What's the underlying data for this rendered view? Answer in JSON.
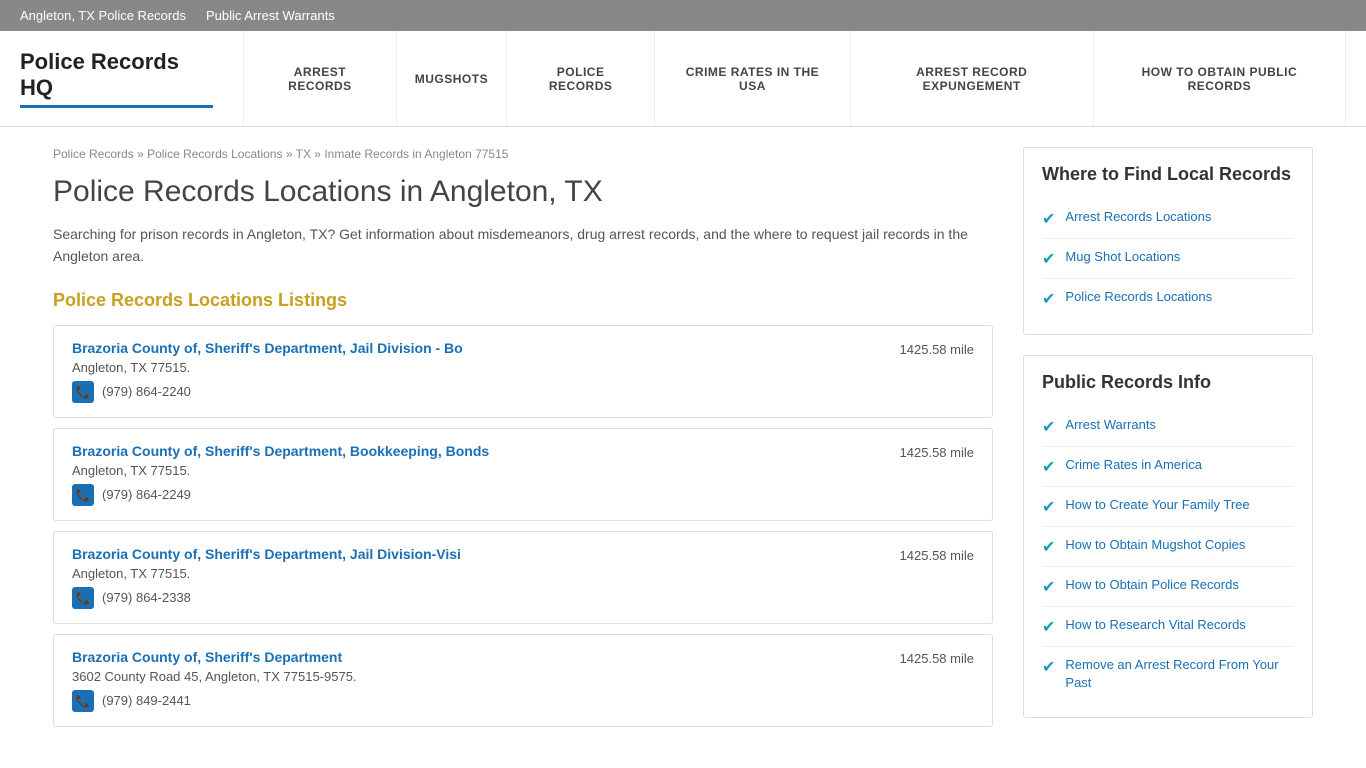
{
  "topbar": {
    "links": [
      {
        "label": "Angleton, TX Police Records",
        "href": "#"
      },
      {
        "label": "Public Arrest Warrants",
        "href": "#"
      }
    ]
  },
  "header": {
    "logo": "Police Records HQ",
    "nav": [
      {
        "label": "ARREST RECORDS",
        "href": "#"
      },
      {
        "label": "MUGSHOTS",
        "href": "#"
      },
      {
        "label": "POLICE RECORDS",
        "href": "#"
      },
      {
        "label": "CRIME RATES IN THE USA",
        "href": "#"
      },
      {
        "label": "ARREST RECORD EXPUNGEMENT",
        "href": "#"
      },
      {
        "label": "HOW TO OBTAIN PUBLIC RECORDS",
        "href": "#"
      }
    ]
  },
  "breadcrumb": {
    "items": [
      {
        "label": "Police Records",
        "href": "#"
      },
      {
        "label": "Police Records Locations",
        "href": "#"
      },
      {
        "label": "TX",
        "href": "#"
      },
      {
        "label": "Inmate Records in Angleton 77515",
        "href": "#"
      }
    ]
  },
  "page": {
    "title": "Police Records Locations in Angleton, TX",
    "intro": "Searching for prison records in Angleton, TX? Get information about misdemeanors, drug arrest records, and the where to request jail records in the Angleton area.",
    "section_heading": "Police Records Locations Listings"
  },
  "listings": [
    {
      "name": "Brazoria County of, Sheriff's Department, Jail Division - Bo",
      "address": "Angleton, TX 77515.",
      "phone": "(979) 864-2240",
      "distance": "1425.58 mile"
    },
    {
      "name": "Brazoria County of, Sheriff's Department, Bookkeeping, Bonds",
      "address": "Angleton, TX 77515.",
      "phone": "(979) 864-2249",
      "distance": "1425.58 mile"
    },
    {
      "name": "Brazoria County of, Sheriff's Department, Jail Division-Visi",
      "address": "Angleton, TX 77515.",
      "phone": "(979) 864-2338",
      "distance": "1425.58 mile"
    },
    {
      "name": "Brazoria County of, Sheriff's Department",
      "address": "3602 County Road 45, Angleton, TX 77515-9575.",
      "phone": "(979) 849-2441",
      "distance": "1425.58 mile"
    }
  ],
  "sidebar": {
    "where_to_find": {
      "title": "Where to Find Local Records",
      "links": [
        {
          "label": "Arrest Records Locations"
        },
        {
          "label": "Mug Shot Locations"
        },
        {
          "label": "Police Records Locations"
        }
      ]
    },
    "public_records": {
      "title": "Public Records Info",
      "links": [
        {
          "label": "Arrest Warrants"
        },
        {
          "label": "Crime Rates in America"
        },
        {
          "label": "How to Create Your Family Tree"
        },
        {
          "label": "How to Obtain Mugshot Copies"
        },
        {
          "label": "How to Obtain Police Records"
        },
        {
          "label": "How to Research Vital Records"
        },
        {
          "label": "Remove an Arrest Record From Your Past"
        }
      ]
    }
  }
}
